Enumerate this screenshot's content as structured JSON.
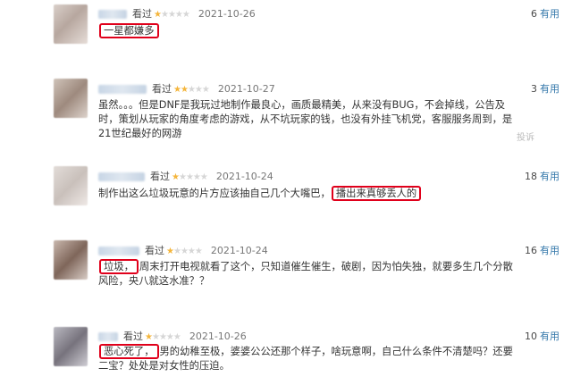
{
  "reviews": [
    {
      "status": "看过",
      "stars_filled": 1,
      "stars_total": 5,
      "date": "2021-10-26",
      "useful_count": "6",
      "useful_label": "有用",
      "content_pre": "",
      "highlight": "一星都嫌多",
      "content_post": "",
      "report": ""
    },
    {
      "status": "看过",
      "stars_filled": 2,
      "stars_total": 5,
      "date": "2021-10-27",
      "useful_count": "3",
      "useful_label": "有用",
      "content_pre": "虽然。。。但是DNF是我玩过地制作最良心，画质最精美，从来没有BUG，不会掉线，公告及时，策划从玩家的角度考虑的游戏，从不坑玩家的钱，也没有外挂飞机党，客服服务周到，是21世纪最好的网游",
      "highlight": "",
      "content_post": "",
      "report": "投诉"
    },
    {
      "status": "看过",
      "stars_filled": 1,
      "stars_total": 5,
      "date": "2021-10-24",
      "useful_count": "18",
      "useful_label": "有用",
      "content_pre": "制作出这么垃圾玩意的片方应该抽自己几个大嘴巴，",
      "highlight": "播出来真够丢人的",
      "content_post": "",
      "report": ""
    },
    {
      "status": "看过",
      "stars_filled": 1,
      "stars_total": 5,
      "date": "2021-10-24",
      "useful_count": "16",
      "useful_label": "有用",
      "content_pre": "",
      "highlight": "垃圾，",
      "content_post": "周末打开电视就看了这个，只知道催生催生，破剧，因为怕失独，就要多生几个分散风险，央八就这水准？？",
      "report": ""
    },
    {
      "status": "看过",
      "stars_filled": 1,
      "stars_total": 5,
      "date": "2021-10-26",
      "useful_count": "10",
      "useful_label": "有用",
      "content_pre": "",
      "highlight": "恶心死了，",
      "content_post": "男的幼稚至极，婆婆公公还那个样子，啥玩意啊，自己什么条件不清楚吗？还要二宝？处处是对女性的压迫。",
      "report": ""
    }
  ]
}
